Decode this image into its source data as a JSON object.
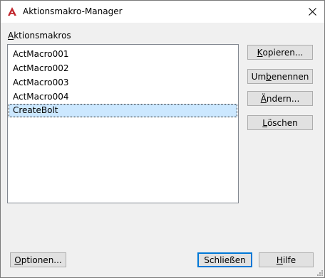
{
  "window": {
    "title": "Aktionsmakro-Manager",
    "close_label": "×"
  },
  "list": {
    "label_accesskey": "A",
    "label_rest": "ktionsmakros",
    "items": [
      "ActMacro001",
      "ActMacro002",
      "ActMacro003",
      "ActMacro004",
      "CreateBolt"
    ],
    "selected_index": 4
  },
  "buttons": {
    "copy": {
      "ak": "K",
      "rest": "opieren..."
    },
    "rename": {
      "pre": "Um",
      "ak": "b",
      "rest": "enennen"
    },
    "modify": {
      "ak": "Ä",
      "rest": "ndern..."
    },
    "delete": {
      "ak": "L",
      "rest": "öschen"
    },
    "options": {
      "ak": "O",
      "rest": "ptionen..."
    },
    "close": {
      "label": "Schließen"
    },
    "help": {
      "ak": "H",
      "rest": "ilfe"
    }
  },
  "colors": {
    "app_icon_red": "#c1272d",
    "selection_bg": "#cce8ff",
    "default_button_border": "#0078d7"
  }
}
